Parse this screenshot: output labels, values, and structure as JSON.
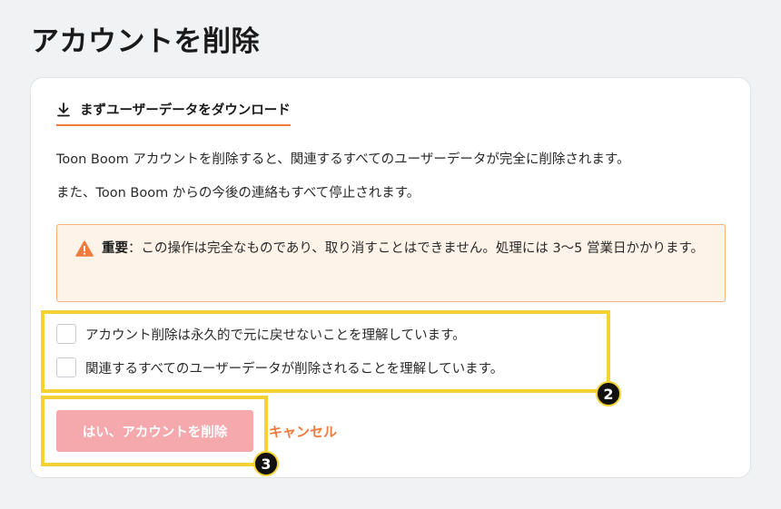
{
  "page": {
    "title": "アカウントを削除"
  },
  "download": {
    "label": "まずユーザーデータをダウンロード",
    "icon": "download-icon"
  },
  "description": {
    "line1": "Toon Boom アカウントを削除すると、関連するすべてのユーザーデータが完全に削除されます。",
    "line2": "また、Toon Boom からの今後の連絡もすべて停止されます。"
  },
  "warning": {
    "icon": "warning-icon",
    "strong": "重要",
    "text": "：この操作は完全なものであり、取り消すことはできません。処理には 3〜5 営業日かかります。"
  },
  "checkboxes": [
    {
      "label": "アカウント削除は永久的で元に戻せないことを理解しています。",
      "checked": false
    },
    {
      "label": "関連するすべてのユーザーデータが削除されることを理解しています。",
      "checked": false
    }
  ],
  "actions": {
    "confirm_label": "はい、アカウントを削除",
    "cancel_label": "キャンセル"
  },
  "annotations": {
    "badge_2": "2",
    "badge_3": "3"
  },
  "colors": {
    "accent": "#f07b3d",
    "confirm_disabled": "#f5a9ad",
    "warning_bg": "#fdf3e8",
    "warning_border": "#f0b27a",
    "highlight": "#f5d233"
  }
}
